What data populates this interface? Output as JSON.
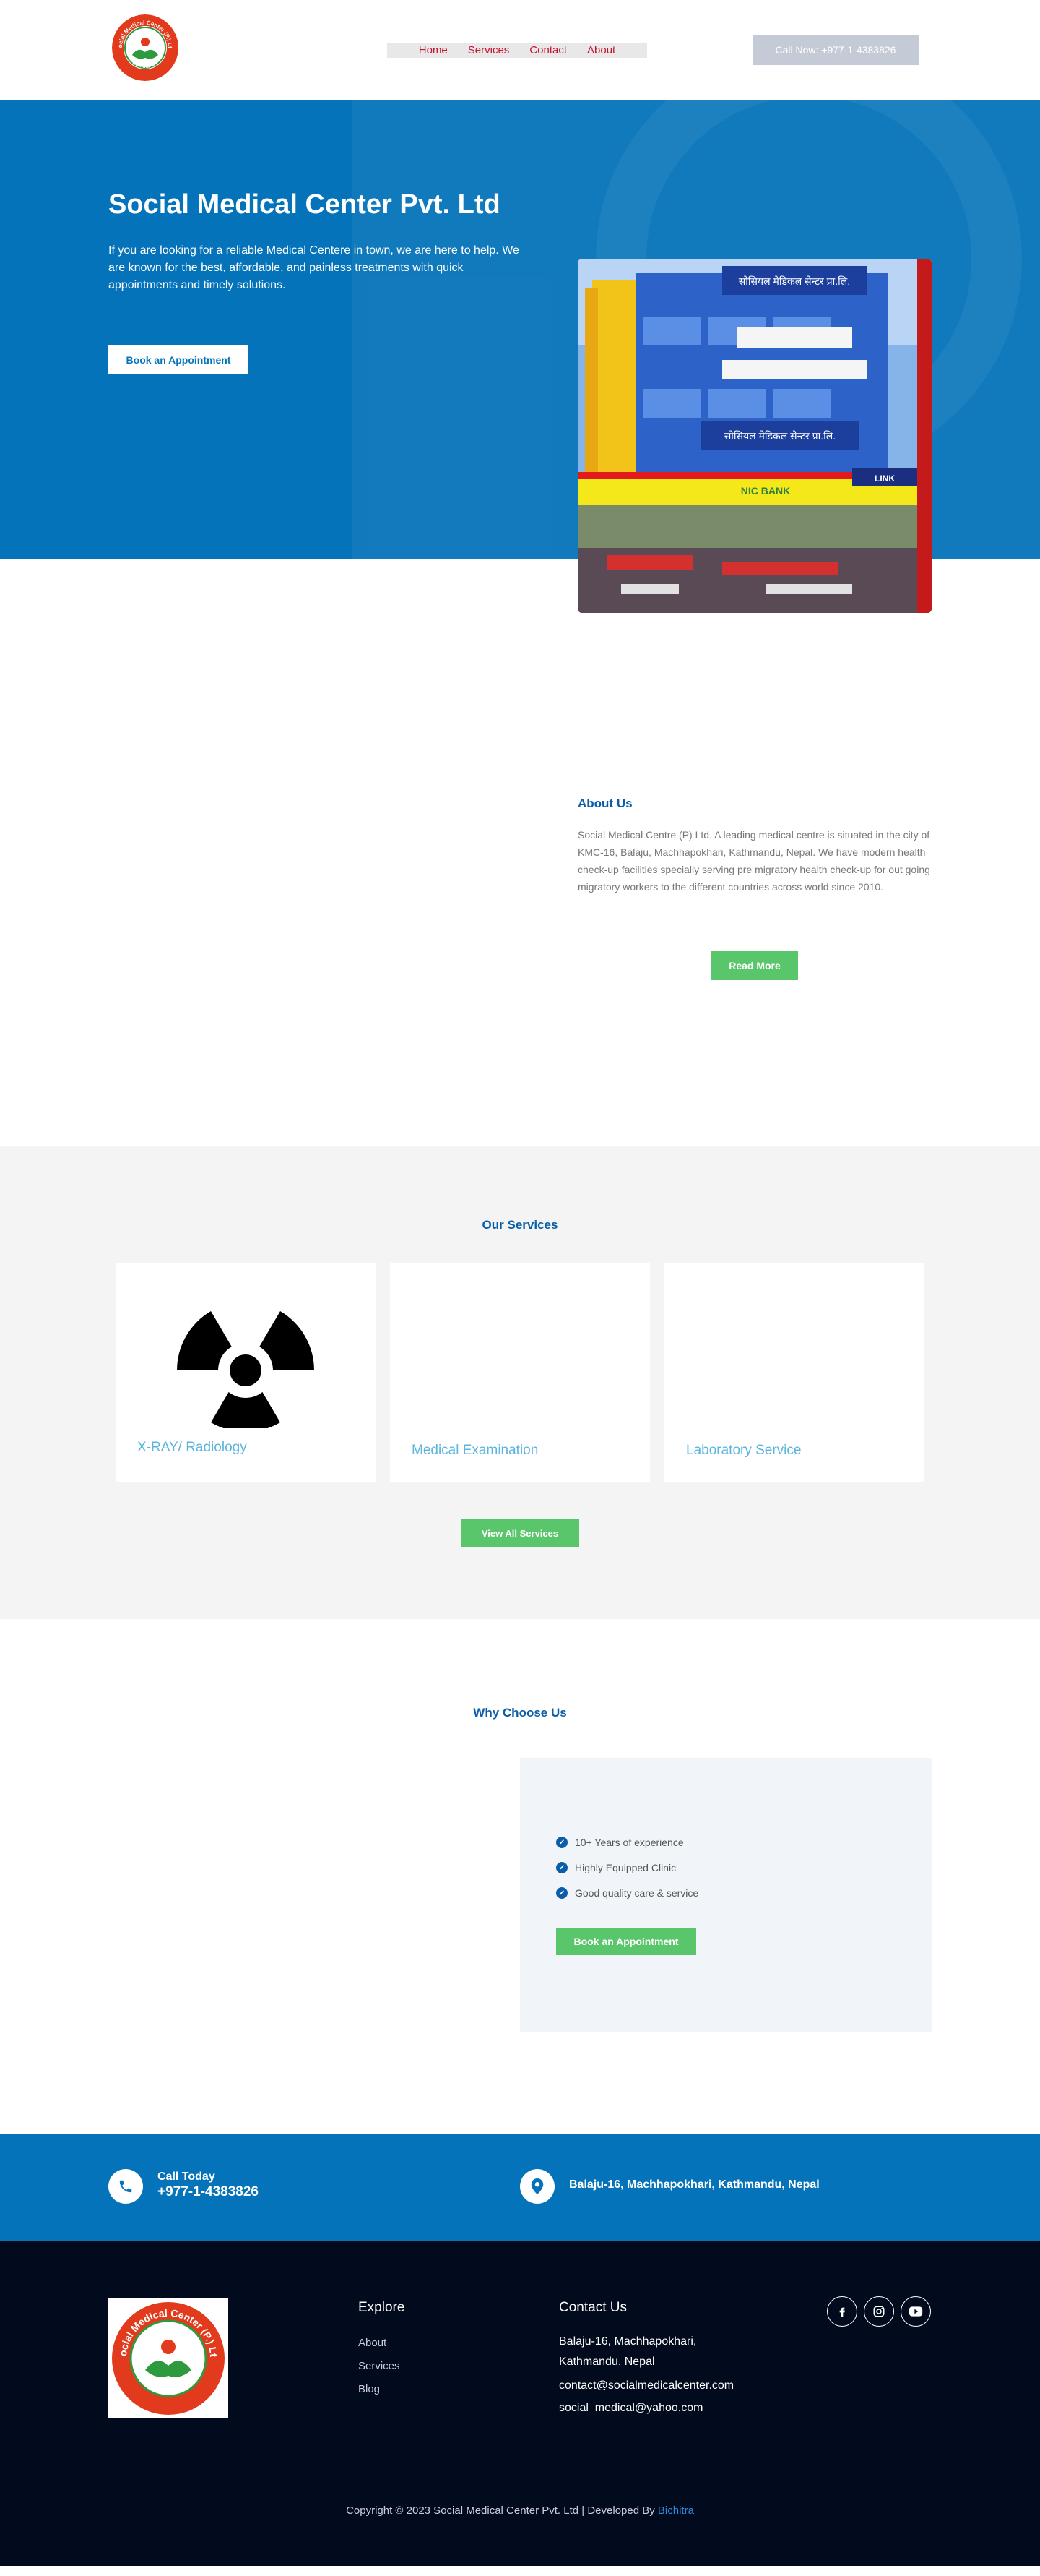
{
  "header": {
    "logo": {
      "ring_text": "Social Medical Center (P.) Ltd",
      "city_text": "Kathmandu"
    },
    "nav": [
      {
        "label": "Home"
      },
      {
        "label": "Services"
      },
      {
        "label": "Contact"
      },
      {
        "label": "About"
      }
    ],
    "call_button": "Call Now: +977-1-4383826"
  },
  "hero": {
    "title": "Social Medical Center Pvt. Ltd",
    "text": "If you are looking for a reliable Medical Centere in town, we are here to help. We are known for the best, affordable, and painless treatments with quick appointments and timely solutions.",
    "button": "Book an Appointment",
    "image": {
      "sign_top": "सोसियल मेडिकल सेन्टर प्रा.लि.",
      "sign_mid": "सोसियल मेडिकल सेन्टर प्रा.लि.",
      "bank_sign": "NIC BANK",
      "link_sign": "LINK"
    }
  },
  "about": {
    "title": "About Us",
    "text": "Social Medical Centre (P) Ltd. A leading medical centre is situated in the city of KMC-16, Balaju, Machhapokhari, Kathmandu, Nepal. We have modern health check-up facilities specially serving pre migratory health check-up for out going migratory workers to the different countries across world since 2010.",
    "button": "Read More"
  },
  "services": {
    "title": "Our Services",
    "cards": [
      {
        "title": "X-RAY/ Radiology",
        "icon": "radiation-icon"
      },
      {
        "title": "Medical Examination"
      },
      {
        "title": "Laboratory Service"
      }
    ],
    "button": "View All Services"
  },
  "why": {
    "title": "Why Choose Us",
    "items": [
      {
        "label": "10+ Years of experience"
      },
      {
        "label": "Highly Equipped Clinic"
      },
      {
        "label": "Good quality care & service"
      }
    ],
    "button": "Book an Appointment"
  },
  "contact_bar": {
    "call_label": "Call Today",
    "call_number": "+977-1-4383826",
    "address": "Balaju-16, Machhapokhari, Kathmandu, Nepal"
  },
  "footer": {
    "explore_title": "Explore",
    "explore_links": [
      {
        "label": "About"
      },
      {
        "label": "Services"
      },
      {
        "label": "Blog"
      }
    ],
    "contact_title": "Contact Us",
    "address_line1": "Balaju-16, Machhapokhari,",
    "address_line2": "Kathmandu, Nepal",
    "email1": "contact@socialmedicalcenter.com",
    "email2": "social_medical@yahoo.com",
    "copyright_prefix": "Copyright © 2023 Social Medical Center Pvt. Ltd | Developed By ",
    "developer": "Bichitra"
  },
  "colors": {
    "primary_blue": "#0573b9",
    "heading_blue": "#0a5ea8",
    "green": "#5ac66c",
    "nav_red": "#c8102e",
    "footer_bg": "#020b1d"
  }
}
